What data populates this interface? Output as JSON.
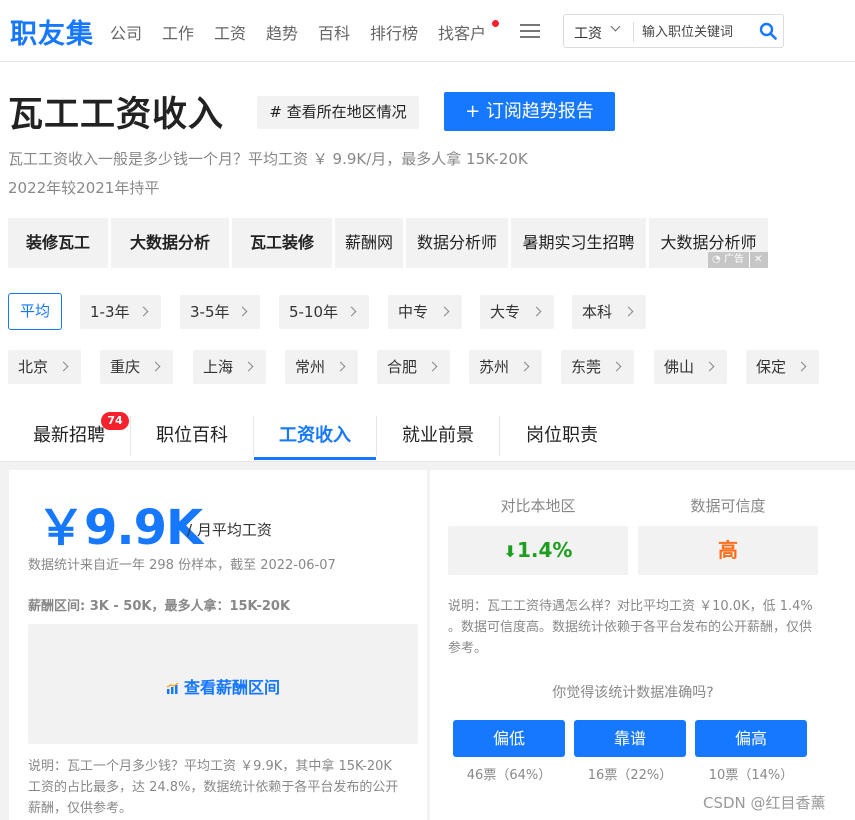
{
  "header": {
    "logo": "职友集",
    "nav": [
      "公司",
      "工作",
      "工资",
      "趋势",
      "百科",
      "排行榜",
      "找客户"
    ],
    "search_type": "工资",
    "search_placeholder": "输入职位关键词"
  },
  "title": {
    "main": "瓦工工资收入",
    "region_tag": "# 查看所在地区情况",
    "subscribe": "+ 订阅趋势报告",
    "intro1": "瓦工工资收入一般是多少钱一个月？平均工资 ￥ 9.9K/月，最多人拿 15K-20K",
    "intro2": "2022年较2021年持平"
  },
  "keywords": [
    "装修瓦工",
    "大数据分析",
    "瓦工装修",
    "薪酬网",
    "数据分析师",
    "暑期实习生招聘",
    "大数据分析师"
  ],
  "ad_label": "广告",
  "experience_filters": [
    "平均",
    "1-3年",
    "3-5年",
    "5-10年",
    "中专",
    "大专",
    "本科"
  ],
  "city_filters": [
    "北京",
    "重庆",
    "上海",
    "常州",
    "合肥",
    "苏州",
    "东莞",
    "佛山",
    "保定"
  ],
  "tabs": {
    "items": [
      "最新招聘",
      "职位百科",
      "工资收入",
      "就业前景",
      "岗位职责"
    ],
    "badge": "74",
    "active": "工资收入"
  },
  "salary": {
    "value": "￥9.9K",
    "unit": "/ 月平均工资",
    "stat_note": "数据统计来自近一年 298 份样本，截至 2022-06-07",
    "range_text": "薪酬区间: 3K - 50K，最多人拿：15K-20K",
    "range_link": "查看薪酬区间",
    "note": "说明：瓦工一个月多少钱？平均工资 ￥9.9K，其中拿 15K-20K 工资的占比最多，达 24.8%，数据统计依赖于各平台发布的公开薪酬，仅供参考。"
  },
  "compare": {
    "region_label": "对比本地区",
    "region_value": "1.4%",
    "confidence_label": "数据可信度",
    "confidence_value": "高",
    "note": "说明：瓦工工资待遇怎么样？对比平均工资 ￥10.0K，低 1.4% 。数据可信度高。数据统计依赖于各平台发布的公开薪酬，仅供参考。",
    "vote_question": "你觉得该统计数据准确吗?",
    "votes": [
      {
        "label": "偏低",
        "count": "46票（64%）"
      },
      {
        "label": "靠谱",
        "count": "16票（22%）"
      },
      {
        "label": "偏高",
        "count": "10票（14%）"
      }
    ]
  },
  "watermark": "CSDN @红目香薰",
  "colors": {
    "accent": "#1677ff",
    "badge": "#f5222d",
    "down": "#1e9e1e",
    "high": "#fa6f1e"
  }
}
